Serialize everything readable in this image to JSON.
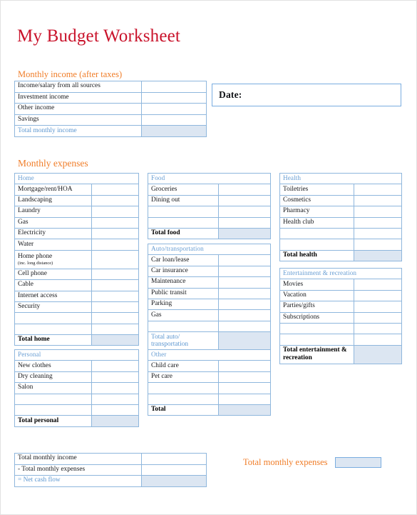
{
  "document": {
    "title": "My Budget Worksheet",
    "title_color": "#c9132b",
    "accent_color": "#f07d28",
    "table_border_color": "#8fb7dd",
    "total_fill_color": "#dce6f2"
  },
  "income_section": {
    "heading": "Monthly income (after taxes)",
    "rows": [
      {
        "label": "Income/salary from all sources",
        "value": ""
      },
      {
        "label": "Investment income",
        "value": ""
      },
      {
        "label": "Other income",
        "value": ""
      },
      {
        "label": "Savings",
        "value": ""
      }
    ],
    "total": {
      "label": "Total monthly income",
      "value": ""
    }
  },
  "date_box": {
    "label": "Date:",
    "value": ""
  },
  "expenses_section": {
    "heading": "Monthly expenses",
    "tables": {
      "home": {
        "header": "Home",
        "rows": [
          {
            "label": "Mortgage/rent/HOA",
            "value": ""
          },
          {
            "label": "Landscaping",
            "value": ""
          },
          {
            "label": "Laundry",
            "value": ""
          },
          {
            "label": "Gas",
            "value": ""
          },
          {
            "label": "Electricity",
            "value": ""
          },
          {
            "label": "Water",
            "value": ""
          },
          {
            "label": "Home phone",
            "sublabel": "(inc. long distance)",
            "value": ""
          },
          {
            "label": "Cell phone",
            "value": ""
          },
          {
            "label": "Cable",
            "value": ""
          },
          {
            "label": "Internet access",
            "value": ""
          },
          {
            "label": "Security",
            "value": ""
          },
          {
            "label": "",
            "value": ""
          },
          {
            "label": "",
            "value": ""
          }
        ],
        "total": {
          "label": "Total home",
          "value": ""
        }
      },
      "personal": {
        "header": "Personal",
        "rows": [
          {
            "label": "New clothes",
            "value": ""
          },
          {
            "label": "Dry cleaning",
            "value": ""
          },
          {
            "label": "Salon",
            "value": ""
          },
          {
            "label": "",
            "value": ""
          },
          {
            "label": "",
            "value": ""
          }
        ],
        "total": {
          "label": "Total personal",
          "value": ""
        }
      },
      "food": {
        "header": "Food",
        "rows": [
          {
            "label": "Groceries",
            "value": ""
          },
          {
            "label": "Dining out",
            "value": ""
          },
          {
            "label": "",
            "value": ""
          },
          {
            "label": "",
            "value": ""
          }
        ],
        "total": {
          "label": "Total food",
          "value": ""
        }
      },
      "auto": {
        "header": "Auto/transportation",
        "rows": [
          {
            "label": "Car loan/lease",
            "value": ""
          },
          {
            "label": "Car insurance",
            "value": ""
          },
          {
            "label": "Maintenance",
            "value": ""
          },
          {
            "label": "Public transit",
            "value": ""
          },
          {
            "label": "Parking",
            "value": ""
          },
          {
            "label": "Gas",
            "value": ""
          },
          {
            "label": "",
            "value": ""
          }
        ],
        "total": {
          "label": "Total auto/ transportation",
          "value": ""
        }
      },
      "other": {
        "header": "Other",
        "rows": [
          {
            "label": "Child care",
            "value": ""
          },
          {
            "label": "Pet care",
            "value": ""
          },
          {
            "label": "",
            "value": ""
          },
          {
            "label": "",
            "value": ""
          }
        ],
        "total": {
          "label": "Total",
          "value": ""
        }
      },
      "health": {
        "header": "Health",
        "rows": [
          {
            "label": "Toiletries",
            "value": ""
          },
          {
            "label": "Cosmetics",
            "value": ""
          },
          {
            "label": "Pharmacy",
            "value": ""
          },
          {
            "label": "Health club",
            "value": ""
          },
          {
            "label": "",
            "value": ""
          },
          {
            "label": "",
            "value": ""
          }
        ],
        "total": {
          "label": "Total health",
          "value": ""
        }
      },
      "entertainment": {
        "header": "Entertainment & recreation",
        "rows": [
          {
            "label": "Movies",
            "value": ""
          },
          {
            "label": "Vacation",
            "value": ""
          },
          {
            "label": "Parties/gifts",
            "value": ""
          },
          {
            "label": "Subscriptions",
            "value": ""
          },
          {
            "label": "",
            "value": ""
          },
          {
            "label": "",
            "value": ""
          }
        ],
        "total": {
          "label": "Total entertainment & recreation",
          "value": ""
        }
      }
    }
  },
  "footer": {
    "net_table": {
      "rows": [
        {
          "label": "Total monthly income",
          "value": ""
        },
        {
          "label": "- Total monthly expenses",
          "value": ""
        }
      ],
      "net": {
        "label": "= Net cash flow",
        "value": ""
      }
    },
    "total_expenses": {
      "label": "Total monthly expenses",
      "value": ""
    }
  }
}
